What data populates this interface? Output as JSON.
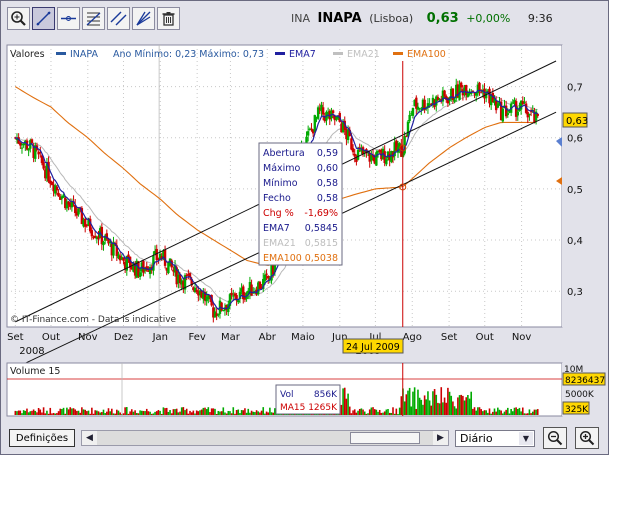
{
  "header": {
    "code": "INA",
    "name": "INAPA",
    "exchange": "(Lisboa)",
    "price": "0,63",
    "change": "+0,00%",
    "time": "9:36"
  },
  "toolbar": {
    "tools": [
      "zoom-tool-icon",
      "trendline-tool-icon",
      "horizontal-line-tool-icon",
      "fibonacci-tool-icon",
      "channel-tool-icon",
      "fan-tool-icon",
      "trash-icon"
    ]
  },
  "legend": {
    "label": "Valores",
    "series_name": "INAPA",
    "range_text": "Ano Mínimo: 0,23 Máximo: 0,73",
    "ema7": "EMA7",
    "ema21": "EMA21",
    "ema100": "EMA100"
  },
  "colors": {
    "up": "#00aa00",
    "down": "#cc0000",
    "ema7": "#2020a0",
    "ema21": "#b8b8b8",
    "ema100": "#e07010",
    "cursor": "#cc0000",
    "grid": "#c8c8c8"
  },
  "tooltip": {
    "rows": [
      {
        "label": "Abertura",
        "value": "0,59",
        "color": "#1a1a8c"
      },
      {
        "label": "Máximo",
        "value": "0,60",
        "color": "#1a1a8c"
      },
      {
        "label": "Mínimo",
        "value": "0,58",
        "color": "#1a1a8c"
      },
      {
        "label": "Fecho",
        "value": "0,58",
        "color": "#1a1a8c"
      },
      {
        "label": "Chg %",
        "value": "-1,69%",
        "color": "#cc0000"
      },
      {
        "label": "EMA7",
        "value": "0,5845",
        "color": "#1a1a8c"
      },
      {
        "label": "EMA21",
        "value": "0,5815",
        "color": "#bdbdbd"
      },
      {
        "label": "EMA100",
        "value": "0,5038",
        "color": "#e07010"
      }
    ]
  },
  "cursor_date": "24 Jul 2009",
  "price_tag": "0,63",
  "watermark": "© IT-Finance.com - Data is indicative",
  "volume": {
    "label": "Volume 15",
    "tooltip_vol_label": "Vol",
    "tooltip_vol_value": "856K",
    "tooltip_ma_label": "MA15",
    "tooltip_ma_value": "1265K",
    "axis_top": "8236437",
    "axis_mid": "5000K",
    "axis_tag": "325K",
    "axis_partial": "10M"
  },
  "bottom": {
    "definitions_label": "Definições",
    "period_selected": "Diário"
  },
  "chart_data": {
    "type": "candlestick",
    "title": "",
    "x_ticks": [
      "Set",
      "Out",
      "Nov",
      "Dez",
      "Jan",
      "Fev",
      "Mar",
      "Abr",
      "Maio",
      "Jun",
      "Jul",
      "Ago",
      "Set",
      "Out",
      "Nov"
    ],
    "x_year_labels": [
      "2008",
      "2009"
    ],
    "y_ticks": [
      "0,3",
      "0,4",
      "0,5",
      "0,6",
      "0,7"
    ],
    "ylim": [
      0.23,
      0.75
    ],
    "close_series": {
      "name": "INAPA",
      "dates": [
        "2008-09-01",
        "2008-09-15",
        "2008-10-01",
        "2008-10-15",
        "2008-11-01",
        "2008-11-15",
        "2008-12-01",
        "2008-12-15",
        "2009-01-01",
        "2009-01-15",
        "2009-02-01",
        "2009-02-15",
        "2009-03-01",
        "2009-03-15",
        "2009-04-01",
        "2009-04-15",
        "2009-05-01",
        "2009-05-15",
        "2009-06-01",
        "2009-06-15",
        "2009-07-01",
        "2009-07-24",
        "2009-08-01",
        "2009-08-15",
        "2009-09-01",
        "2009-09-15",
        "2009-10-01",
        "2009-10-15",
        "2009-11-01",
        "2009-11-15"
      ],
      "values": [
        0.6,
        0.58,
        0.52,
        0.47,
        0.43,
        0.4,
        0.36,
        0.34,
        0.37,
        0.33,
        0.31,
        0.26,
        0.28,
        0.3,
        0.32,
        0.39,
        0.58,
        0.65,
        0.63,
        0.57,
        0.56,
        0.58,
        0.66,
        0.67,
        0.68,
        0.7,
        0.69,
        0.65,
        0.66,
        0.63
      ]
    },
    "ema100_series": {
      "name": "EMA100",
      "values": [
        0.7,
        0.68,
        0.66,
        0.63,
        0.6,
        0.57,
        0.54,
        0.51,
        0.48,
        0.45,
        0.42,
        0.4,
        0.38,
        0.36,
        0.35,
        0.36,
        0.4,
        0.45,
        0.48,
        0.49,
        0.5,
        0.5038,
        0.52,
        0.55,
        0.58,
        0.6,
        0.62,
        0.63,
        0.63,
        0.63
      ]
    },
    "channel_upper": {
      "start": [
        "2008-09-01",
        0.24
      ],
      "end": [
        "2009-11-30",
        0.75
      ]
    },
    "channel_lower": {
      "start": [
        "2008-09-01",
        0.15
      ],
      "end": [
        "2009-11-30",
        0.65
      ]
    },
    "cursor": {
      "date": "2009-07-24",
      "open": 0.59,
      "high": 0.6,
      "low": 0.58,
      "close": 0.58,
      "ema7": 0.5845,
      "ema21": 0.5815,
      "ema100": 0.5038
    },
    "volume_series": {
      "name": "Volume",
      "unit": "shares",
      "ylim": [
        0,
        10000000
      ]
    }
  }
}
